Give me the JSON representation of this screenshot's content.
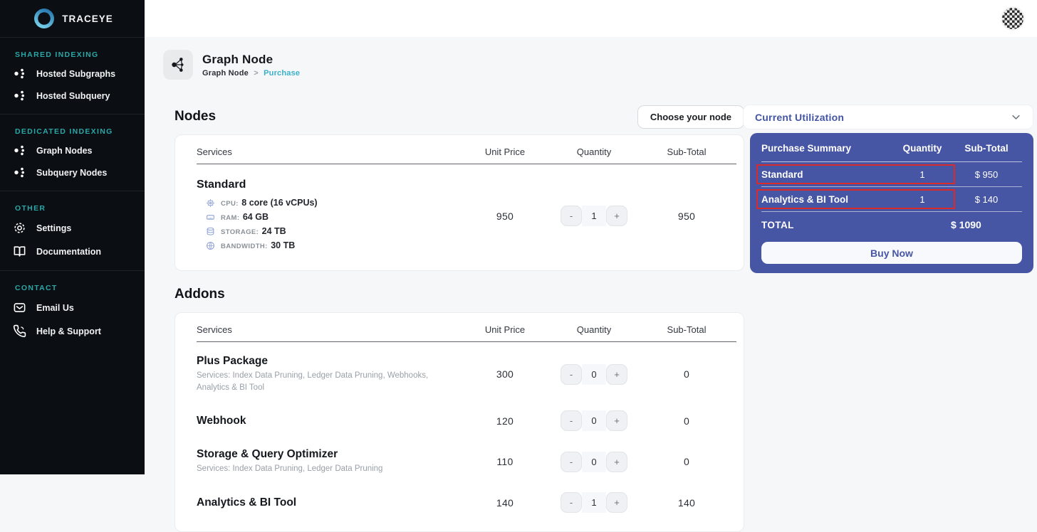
{
  "brand": {
    "name": "TRACEYE"
  },
  "sidebar": {
    "sections": [
      {
        "title": "SHARED INDEXING",
        "items": [
          {
            "label": "Hosted Subgraphs"
          },
          {
            "label": "Hosted Subquery"
          }
        ]
      },
      {
        "title": "DEDICATED INDEXING",
        "items": [
          {
            "label": "Graph Nodes"
          },
          {
            "label": "Subquery Nodes"
          }
        ]
      },
      {
        "title": "OTHER",
        "items": [
          {
            "label": "Settings"
          },
          {
            "label": "Documentation"
          }
        ]
      },
      {
        "title": "CONTACT",
        "items": [
          {
            "label": "Email Us"
          },
          {
            "label": "Help & Support"
          }
        ]
      }
    ]
  },
  "header": {
    "title": "Graph Node",
    "breadcrumb_root": "Graph Node",
    "breadcrumb_separator": ">",
    "breadcrumb_current": "Purchase"
  },
  "columns": {
    "services": "Services",
    "unit_price": "Unit Price",
    "quantity": "Quantity",
    "subtotal": "Sub-Total"
  },
  "nodes": {
    "title": "Nodes",
    "choose_button": "Choose your node",
    "row": {
      "name": "Standard",
      "unit_price": "950",
      "quantity": "1",
      "subtotal": "950",
      "specs": [
        {
          "label": "CPU:",
          "value": "8 core (16 vCPUs)"
        },
        {
          "label": "RAM:",
          "value": "64 GB"
        },
        {
          "label": "STORAGE:",
          "value": "24 TB"
        },
        {
          "label": "BANDWIDTH:",
          "value": "30 TB"
        }
      ]
    }
  },
  "addons": {
    "title": "Addons",
    "rows": [
      {
        "name": "Plus Package",
        "description": "Services: Index Data Pruning, Ledger Data Pruning, Webhooks, Analytics & BI Tool",
        "unit_price": "300",
        "quantity": "0",
        "subtotal": "0"
      },
      {
        "name": "Webhook",
        "description": "",
        "unit_price": "120",
        "quantity": "0",
        "subtotal": "0"
      },
      {
        "name": "Storage & Query Optimizer",
        "description": "Services: Index Data Pruning, Ledger Data Pruning",
        "unit_price": "110",
        "quantity": "0",
        "subtotal": "0"
      },
      {
        "name": "Analytics & BI Tool",
        "description": "",
        "unit_price": "140",
        "quantity": "1",
        "subtotal": "140"
      }
    ]
  },
  "summary": {
    "utilization_label": "Current Utilization",
    "head": {
      "title": "Purchase Summary",
      "quantity": "Quantity",
      "subtotal": "Sub-Total"
    },
    "rows": [
      {
        "name": "Standard",
        "quantity": "1",
        "subtotal": "$ 950"
      },
      {
        "name": "Analytics & BI Tool",
        "quantity": "1",
        "subtotal": "$ 140"
      }
    ],
    "total_label": "TOTAL",
    "total_value": "$ 1090",
    "buy_button": "Buy Now"
  },
  "controls": {
    "minus": "-",
    "plus": "+"
  },
  "colors": {
    "sidebar_bg": "#0b0f13",
    "accent_teal": "#2ba7a7",
    "breadcrumb_cyan": "#3ab0c9",
    "panel_indigo": "#4656a4",
    "highlight_red": "#d92b2b"
  }
}
